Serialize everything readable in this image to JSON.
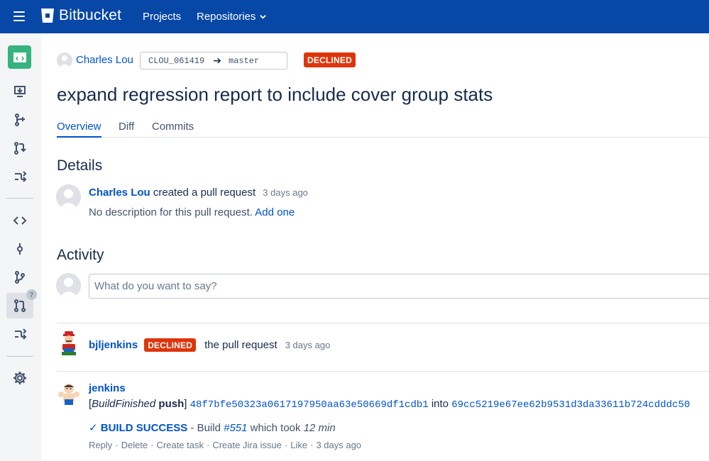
{
  "header": {
    "brand": "Bitbucket",
    "nav_projects": "Projects",
    "nav_repositories": "Repositories"
  },
  "sidebar": {
    "pull_requests_badge": "7"
  },
  "pull_request": {
    "author": "Charles Lou",
    "source_branch": "CLOU_061419",
    "target_branch": "master",
    "status": "DECLINED",
    "title": "expand regression report to include cover group stats",
    "tabs": [
      "Overview",
      "Diff",
      "Commits"
    ]
  },
  "details": {
    "heading": "Details",
    "author": "Charles Lou",
    "action_text": "created a pull request",
    "time": "3 days ago",
    "no_description": "No description for this pull request.",
    "add_one": "Add one"
  },
  "activity": {
    "heading": "Activity",
    "comment_placeholder": "What do you want to say?",
    "items": [
      {
        "user": "bjljenkins",
        "status": "DECLINED",
        "text": "the pull request",
        "time": "3 days ago"
      },
      {
        "user": "jenkins",
        "prefix_open": "[",
        "event": "BuildFinished",
        "event_bold": "push",
        "prefix_close": "]",
        "from_hash": "48f7bfe50323a0617197950aa63e50669df1cdb1",
        "into_text": "into",
        "to_hash": "69cc5219e67ee62b9531d3da33611b724cdddc50",
        "success_label": "✓ BUILD SUCCESS",
        "build_text": " - Build ",
        "build_number": "#551",
        "took_text": " which took ",
        "duration": "12 min",
        "actions": [
          "Reply",
          "Delete",
          "Create task",
          "Create Jira issue",
          "Like"
        ],
        "time": "3 days ago"
      }
    ]
  },
  "colors": {
    "topbar": "#0747a6",
    "link": "#0052cc",
    "declined": "#de350b",
    "repo_avatar": "#36b37e"
  }
}
